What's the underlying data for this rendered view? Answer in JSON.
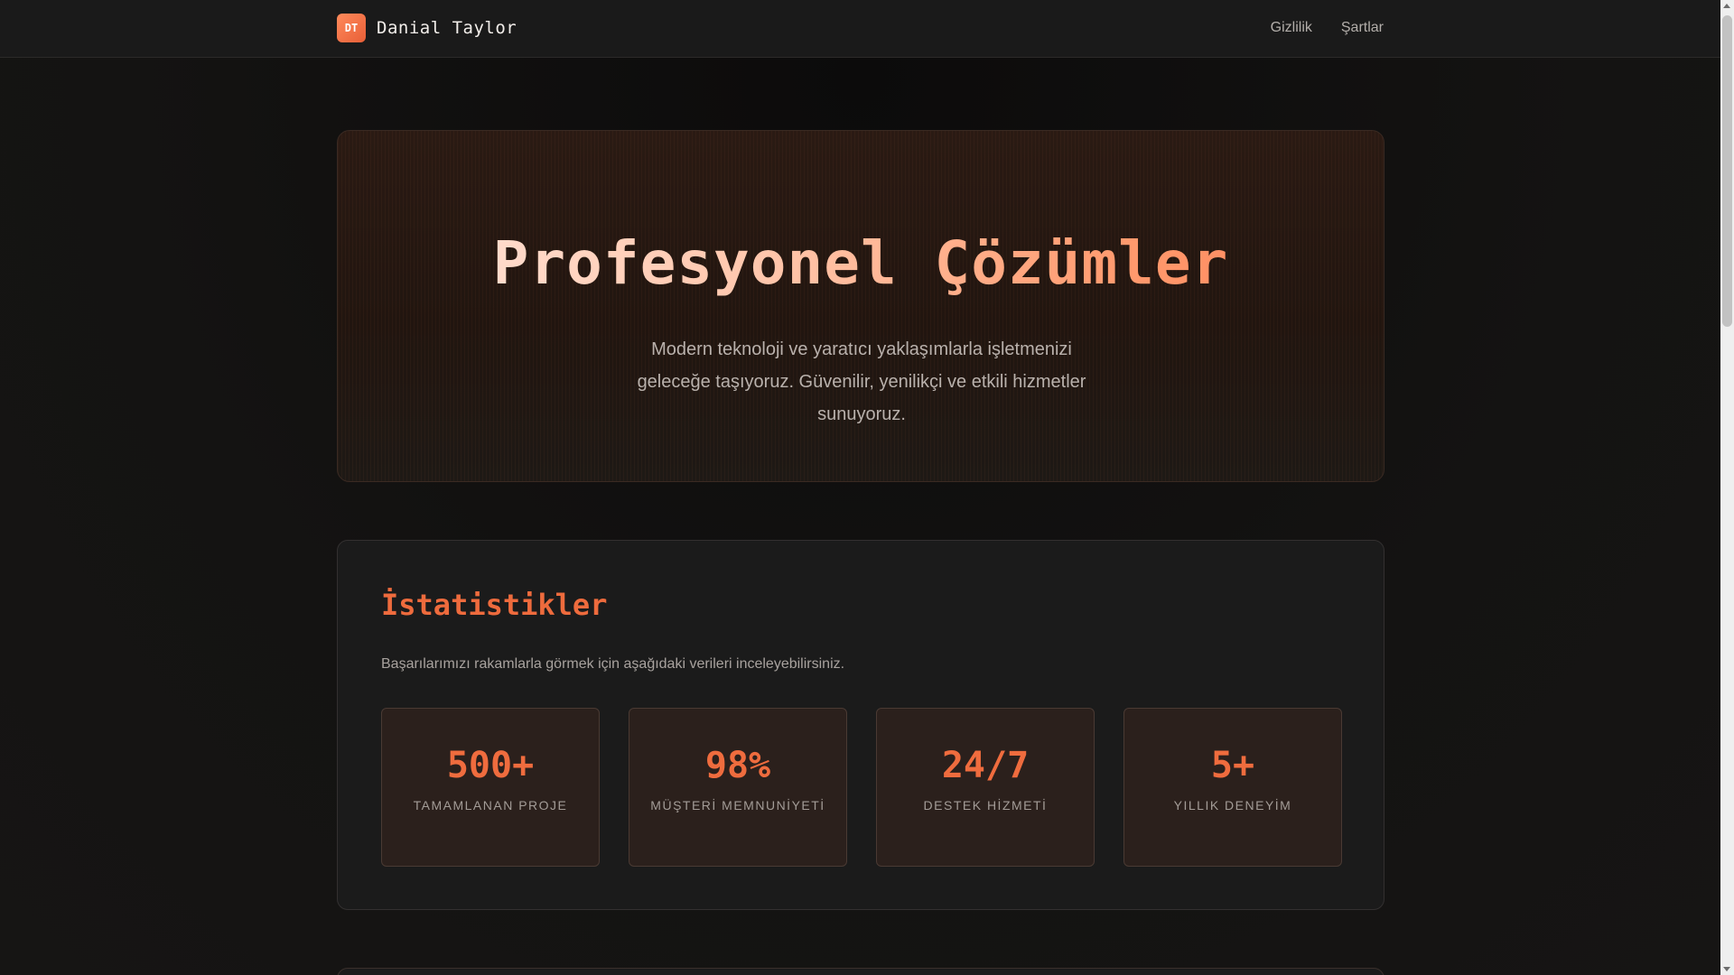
{
  "header": {
    "logo_text": "DT",
    "brand_name": "Danial Taylor",
    "nav": [
      {
        "label": "Gizlilik"
      },
      {
        "label": "Şartlar"
      }
    ]
  },
  "hero": {
    "title": "Profesyonel Çözümler",
    "subtitle": "Modern teknoloji ve yaratıcı yaklaşımlarla işletmenizi geleceğe taşıyoruz. Güvenilir, yenilikçi ve etkili hizmetler sunuyoruz."
  },
  "stats": {
    "title": "İstatistikler",
    "description": "Başarılarımızı rakamlarla görmek için aşağıdaki verileri inceleyebilirsiniz.",
    "items": [
      {
        "value": "500+",
        "label": "TAMAMLANAN PROJE"
      },
      {
        "value": "98%",
        "label": "MÜŞTERİ MEMNUNİYETİ"
      },
      {
        "value": "24/7",
        "label": "DESTEK HİZMETİ"
      },
      {
        "value": "5+",
        "label": "YILLIK DENEYİM"
      }
    ]
  },
  "colors": {
    "accent": "#ee6b3d",
    "background": "#121111",
    "card": "#1b1b1b"
  }
}
